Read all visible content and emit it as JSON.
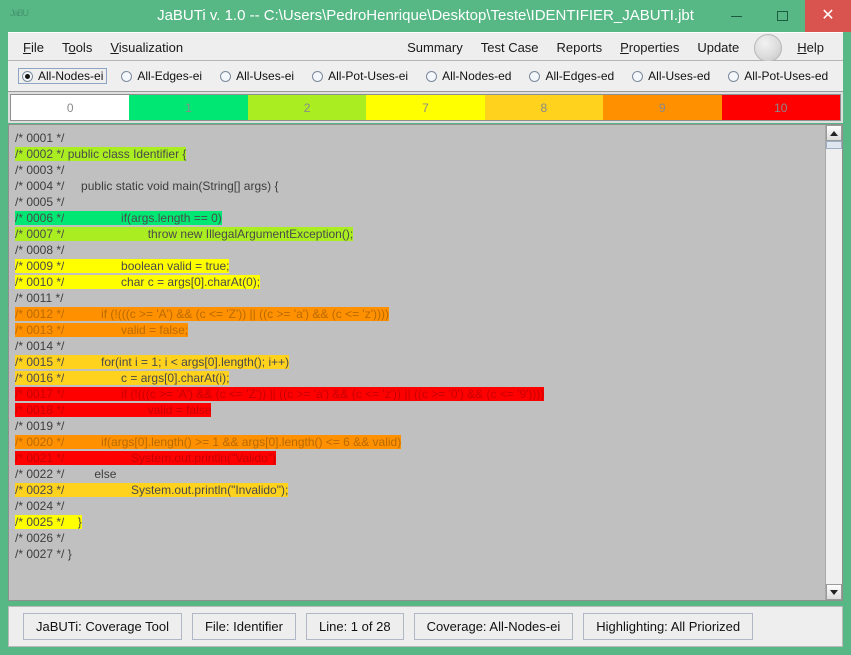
{
  "window": {
    "title": "JaBUTi v. 1.0 -- C:\\Users\\PedroHenrique\\Desktop\\Teste\\IDENTIFIER_JABUTI.jbt",
    "app_icon": "jabuti-logo",
    "controls": {
      "minimize": "minimize-icon",
      "maximize": "maximize-icon",
      "close": "✕"
    }
  },
  "menu": {
    "left": [
      {
        "label": "File",
        "mnemonic": "F"
      },
      {
        "label": "Tools",
        "mnemonic": "o"
      },
      {
        "label": "Visualization",
        "mnemonic": "V"
      }
    ],
    "right": [
      {
        "label": "Summary",
        "mnemonic": ""
      },
      {
        "label": "Test Case",
        "mnemonic": ""
      },
      {
        "label": "Reports",
        "mnemonic": ""
      },
      {
        "label": "Properties",
        "mnemonic": "P"
      },
      {
        "label": "Update",
        "mnemonic": ""
      },
      {
        "label": "Help",
        "mnemonic": "H"
      }
    ],
    "zoom_in": "+",
    "zoom_out": "−"
  },
  "criteria": {
    "selected": "All-Nodes-ei",
    "options": [
      "All-Nodes-ei",
      "All-Edges-ei",
      "All-Uses-ei",
      "All-Pot-Uses-ei",
      "All-Nodes-ed",
      "All-Edges-ed",
      "All-Uses-ed",
      "All-Pot-Uses-ed"
    ]
  },
  "legend": {
    "cells": [
      {
        "label": "0",
        "color": "#ffffff"
      },
      {
        "label": "1",
        "color": "#00e873"
      },
      {
        "label": "2",
        "color": "#aaee22"
      },
      {
        "label": "7",
        "color": "#ffff00"
      },
      {
        "label": "8",
        "color": "#ffd21e"
      },
      {
        "label": "9",
        "color": "#ff9000"
      },
      {
        "label": "10",
        "color": "#ff0000"
      }
    ]
  },
  "code": {
    "lines": [
      {
        "num": "/* 0001 */",
        "text": "",
        "color": null,
        "pad": 0
      },
      {
        "num": "/* 0002 */",
        "text": " public class Identifier {",
        "color": "#aaee22",
        "pad": 0
      },
      {
        "num": "/* 0003 */",
        "text": "",
        "color": null,
        "pad": 0
      },
      {
        "num": "/* 0004 */",
        "text": "     public static void main(String[] args) {",
        "color": null,
        "pad": 0
      },
      {
        "num": "/* 0005 */",
        "text": "",
        "color": null,
        "pad": 0
      },
      {
        "num": "/* 0006 */",
        "text": "                 if(args.length == 0)",
        "color": "#00e873",
        "pad": 0
      },
      {
        "num": "/* 0007 */",
        "text": "                         throw new IllegalArgumentException();",
        "color": "#aaee22",
        "pad": 0
      },
      {
        "num": "/* 0008 */",
        "text": "",
        "color": null,
        "pad": 0
      },
      {
        "num": "/* 0009 */",
        "text": "                 boolean valid = true;",
        "color": "#ffff00",
        "pad": 0
      },
      {
        "num": "/* 0010 */",
        "text": "                 char c = args[0].charAt(0);",
        "color": "#ffff00",
        "pad": 0
      },
      {
        "num": "/* 0011 */",
        "text": "",
        "color": null,
        "pad": 0
      },
      {
        "num": "/* 0012 */",
        "text": "           if (!(((c >= 'A') && (c <= 'Z')) || ((c >= 'a') && (c <= 'z'))))",
        "color": "#ff9000",
        "pad": 0
      },
      {
        "num": "/* 0013 */",
        "text": "                 valid = false;",
        "color": "#ff9000",
        "pad": 0
      },
      {
        "num": "/* 0014 */",
        "text": "",
        "color": null,
        "pad": 0
      },
      {
        "num": "/* 0015 */",
        "text": "           for(int i = 1; i < args[0].length(); i++)",
        "color": "#ffd21e",
        "pad": 0
      },
      {
        "num": "/* 0016 */",
        "text": "                 c = args[0].charAt(i);",
        "color": "#ffd21e",
        "pad": 0
      },
      {
        "num": "/* 0017 */",
        "text": "                 if (!(((c >= 'A') && (c <= 'Z')) || ((c >= 'a') && (c <= 'z')) || ((c >= '0') && (c <= '9'))))",
        "color": "#ff0000",
        "pad": 0
      },
      {
        "num": "/* 0018 */",
        "text": "                         valid = false",
        "color": "#ff0000",
        "pad": 0
      },
      {
        "num": "/* 0019 */",
        "text": "",
        "color": null,
        "pad": 0
      },
      {
        "num": "/* 0020 */",
        "text": "           if(args[0].length() >= 1 && args[0].length() <= 6 && valid)",
        "color": "#ff9000",
        "pad": 0
      },
      {
        "num": "/* 0021 */",
        "text": "                    System.out.println(\"Valido\")",
        "color": "#ff0000",
        "pad": 0
      },
      {
        "num": "/* 0022 */",
        "text": "         else",
        "color": null,
        "pad": 0
      },
      {
        "num": "/* 0023 */",
        "text": "                    System.out.println(\"Invalido\");",
        "color": "#ffd21e",
        "pad": 0
      },
      {
        "num": "/* 0024 */",
        "text": "",
        "color": null,
        "pad": 0
      },
      {
        "num": "/* 0025 */",
        "text": "    }",
        "color": "#ffff00",
        "pad": 0
      },
      {
        "num": "/* 0026 */",
        "text": "",
        "color": null,
        "pad": 0
      },
      {
        "num": "/* 0027 */",
        "text": " }",
        "color": null,
        "pad": 0
      }
    ]
  },
  "scrollbar": {
    "up": "scroll-up-icon",
    "down": "scroll-down-icon"
  },
  "statusbar": {
    "items": [
      "JaBUTi: Coverage Tool",
      "File: Identifier",
      "Line: 1 of 28",
      "Coverage: All-Nodes-ei",
      "Highlighting: All Priorized"
    ]
  }
}
